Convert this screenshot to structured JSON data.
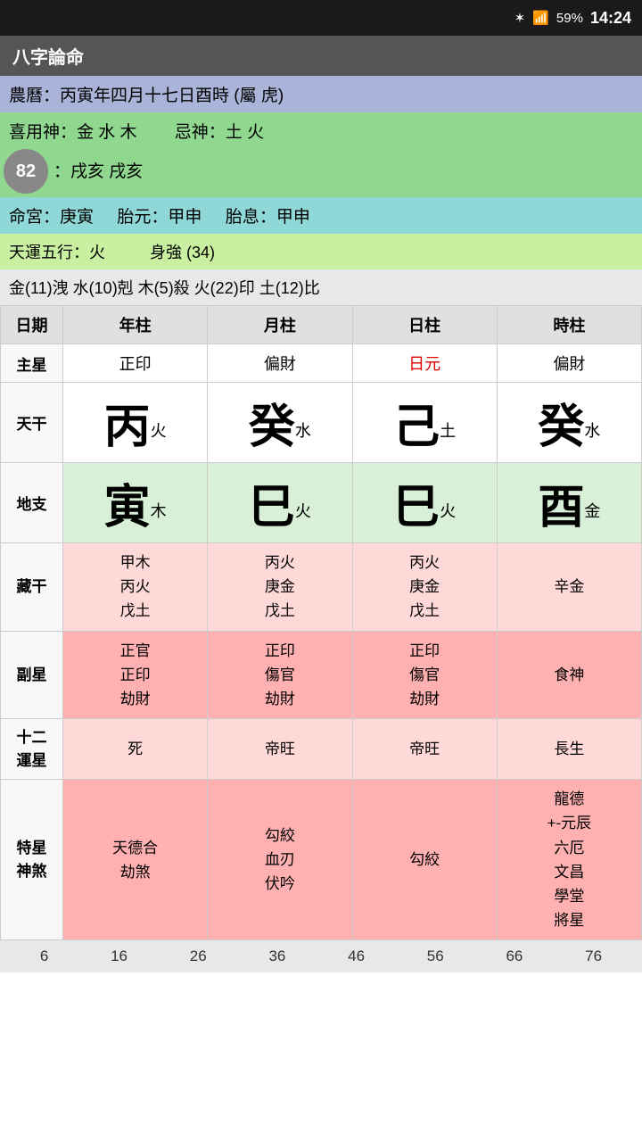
{
  "statusBar": {
    "battery": "59%",
    "time": "14:24"
  },
  "titleBar": {
    "title": "八字論命"
  },
  "info": {
    "lunarDate": "農曆：丙寅年四月十七日酉時 (屬 虎)",
    "favorableGods": "喜用神：金 水 木",
    "avoidGods": "忌神：土 火",
    "badge": "82",
    "liuNian": "：戌亥 戌亥",
    "mingGong": "命宮：庚寅",
    "taiYuan": "胎元：甲申",
    "taiXi": "胎息：甲申",
    "tianYun": "天運五行：火",
    "shenQiang": "身強 (34)",
    "wuXingLine": "金(11)洩  水(10)剋  木(5)殺  火(22)印  土(12)比"
  },
  "tableHeaders": [
    "日期",
    "年柱",
    "月柱",
    "日柱",
    "時柱"
  ],
  "rows": {
    "zhuxing": {
      "label": "主星",
      "year": "正印",
      "month": "偏財",
      "day": "日元",
      "dayRed": true,
      "hour": "偏財"
    },
    "tianGan": {
      "label": "天干",
      "year": {
        "big": "丙",
        "small": "火"
      },
      "month": {
        "big": "癸",
        "small": "水"
      },
      "day": {
        "big": "己",
        "small": "土"
      },
      "hour": {
        "big": "癸",
        "small": "水"
      }
    },
    "diZhi": {
      "label": "地支",
      "year": {
        "big": "寅",
        "small": "木"
      },
      "month": {
        "big": "巳",
        "small": "火"
      },
      "day": {
        "big": "巳",
        "small": "火"
      },
      "hour": {
        "big": "酉",
        "small": "金"
      }
    },
    "cangGan": {
      "label": "藏干",
      "year": [
        "甲木",
        "丙火",
        "戊土"
      ],
      "month": [
        "丙火",
        "庚金",
        "戊土"
      ],
      "day": [
        "丙火",
        "庚金",
        "戊土"
      ],
      "hour": [
        "辛金"
      ]
    },
    "fuXing": {
      "label": "副星",
      "year": [
        "正官",
        "正印",
        "劫財"
      ],
      "month": [
        "正印",
        "傷官",
        "劫財"
      ],
      "day": [
        "正印",
        "傷官",
        "劫財"
      ],
      "hour": [
        "食神"
      ]
    },
    "twelveStars": {
      "label": "十二\n運星",
      "year": "死",
      "month": "帝旺",
      "day": "帝旺",
      "hour": "長生"
    },
    "specialStars": {
      "label": "特星\n神煞",
      "year": [
        "天德合",
        "劫煞"
      ],
      "month": [
        "勾絞",
        "血刃",
        "伏吟"
      ],
      "day": [
        "勾絞"
      ],
      "hour": [
        "龍德",
        "+-元辰",
        "六厄",
        "文昌",
        "學堂",
        "將星"
      ]
    }
  },
  "bottomNumbers": [
    "6",
    "16",
    "26",
    "36",
    "46",
    "56",
    "66",
    "76"
  ]
}
